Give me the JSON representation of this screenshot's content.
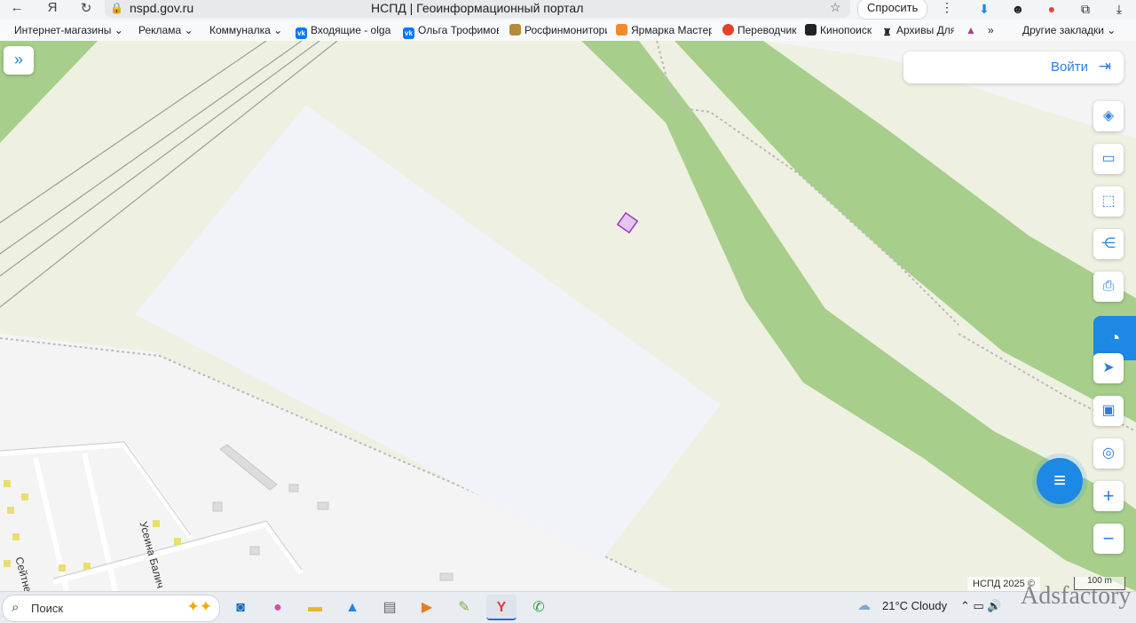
{
  "browser": {
    "url": "nspd.gov.ru",
    "page_title": "НСПД | Геоинформационный портал",
    "ask_button": "Спросить",
    "nav_back": "←",
    "nav_home": "Я",
    "nav_reload": "↻",
    "menu": "⋮"
  },
  "bookmarks": [
    {
      "label": "Интернет-магазины",
      "icon": "folder"
    },
    {
      "label": "Реклама",
      "icon": "folder"
    },
    {
      "label": "Коммуналка",
      "icon": "folder"
    },
    {
      "label": "Входящие - olga-r",
      "icon": "vk"
    },
    {
      "label": "Ольга Трофимова",
      "icon": "vk"
    },
    {
      "label": "Росфинмониторинг",
      "icon": "emblem"
    },
    {
      "label": "Ярмарка Мастеров",
      "icon": "yarmarka"
    },
    {
      "label": "Переводчик",
      "icon": "translate"
    },
    {
      "label": "Кинопоиск",
      "icon": "kinopoisk"
    },
    {
      "label": "Архивы Для",
      "icon": "archive"
    }
  ],
  "bookmarks_more": "»",
  "bookmarks_other": "Другие закладки",
  "map": {
    "login_label": "Войти",
    "streets": [
      "Сейтнеби Абду",
      "Усеина Балич"
    ],
    "attribution": "НСПД 2025 ©",
    "scale_label": "100 m",
    "colors": {
      "background": "#eef0e2",
      "forest": "#a7cf8b",
      "plot": "#f2f2f9",
      "parcel": "#a332c8",
      "accent": "#1e88e5"
    }
  },
  "tools": [
    "layers-icon",
    "ruler-icon",
    "select-area-icon",
    "share-icon",
    "print-icon",
    "location-arrow-icon",
    "picture-in-picture-icon",
    "geo-search-icon",
    "zoom-in-icon",
    "zoom-out-icon"
  ],
  "taskbar": {
    "search_label": "Поиск",
    "weather": "21°C  Cloudy",
    "watermark": "Adsfactory"
  }
}
